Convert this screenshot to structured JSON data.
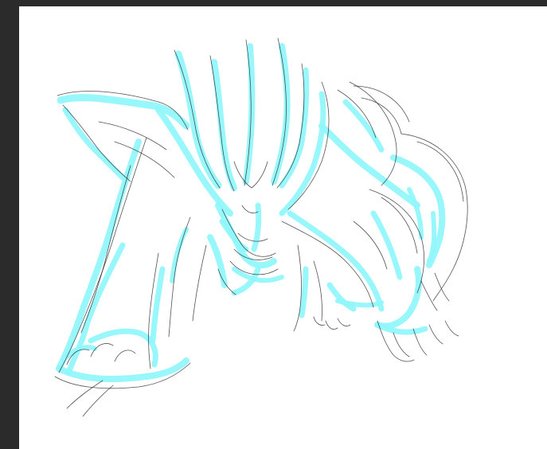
{
  "app": {
    "background_color": "#2b2b2b",
    "canvas_color": "#ffffff"
  },
  "artwork": {
    "description_layers": [
      "cyan-rough-layer",
      "ink-line-layer"
    ],
    "cyan_color": "#8ff6fb",
    "ink_color": "#1a1a1a"
  }
}
